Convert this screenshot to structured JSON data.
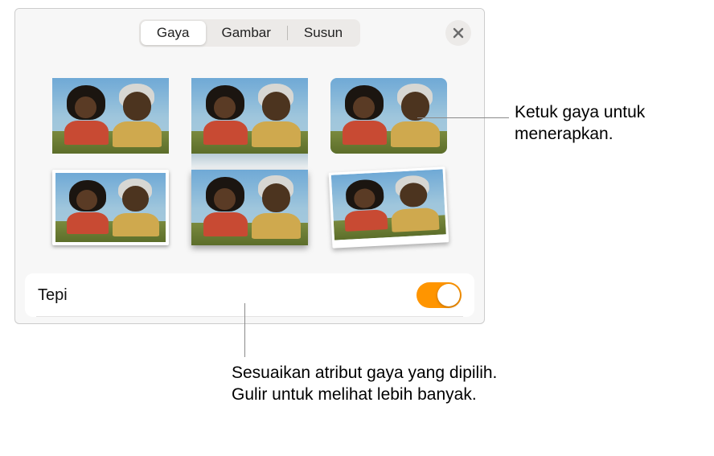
{
  "header": {
    "tabs": [
      {
        "label": "Gaya",
        "active": true
      },
      {
        "label": "Gambar",
        "active": false
      },
      {
        "label": "Susun",
        "active": false
      }
    ],
    "close_icon": "close-icon"
  },
  "styles": {
    "items": [
      {
        "name": "style-plain"
      },
      {
        "name": "style-reflection"
      },
      {
        "name": "style-rounded"
      },
      {
        "name": "style-border-frame"
      },
      {
        "name": "style-drop-shadow"
      },
      {
        "name": "style-polaroid-tilt"
      }
    ]
  },
  "tepi": {
    "label": "Tepi",
    "on": true
  },
  "callouts": {
    "tap_style": "Ketuk gaya untuk menerapkan.",
    "adjust": "Sesuaikan atribut gaya yang dipilih. Gulir untuk melihat lebih banyak."
  },
  "colors": {
    "accent": "#ff9500"
  }
}
